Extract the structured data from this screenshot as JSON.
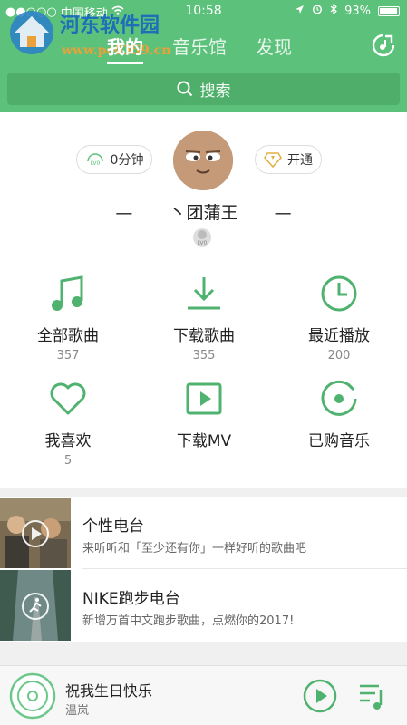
{
  "status": {
    "carrier": "中国移动",
    "time": "10:58",
    "battery": "93%"
  },
  "watermark": {
    "title": "河东软件园",
    "url": "www.pc0359.cn"
  },
  "nav": {
    "tabs": [
      {
        "label": "我的",
        "active": true
      },
      {
        "label": "音乐馆",
        "active": false
      },
      {
        "label": "发现",
        "active": false
      }
    ]
  },
  "search": {
    "placeholder": "搜索"
  },
  "profile": {
    "listen_time": "0分钟",
    "listen_badge": "LV0",
    "vip_label": "开通",
    "username": "丶团蒲王",
    "dash": "—",
    "level_badge": "LV0"
  },
  "grid": [
    {
      "label": "全部歌曲",
      "count": "357",
      "icon": "music-note-icon"
    },
    {
      "label": "下载歌曲",
      "count": "355",
      "icon": "download-icon"
    },
    {
      "label": "最近播放",
      "count": "200",
      "icon": "clock-icon"
    },
    {
      "label": "我喜欢",
      "count": "5",
      "icon": "heart-icon"
    },
    {
      "label": "下载MV",
      "count": "",
      "icon": "video-play-icon"
    },
    {
      "label": "已购音乐",
      "count": "",
      "icon": "purchased-disc-icon"
    }
  ],
  "radios": [
    {
      "title": "个性电台",
      "desc": "来听听和「至少还有你」一样好听的歌曲吧"
    },
    {
      "title": "NIKE跑步电台",
      "desc": "新增万首中文跑步歌曲，点燃你的2017!"
    }
  ],
  "player": {
    "title": "祝我生日快乐",
    "artist": "温岚"
  },
  "colors": {
    "brand_green": "#5cc17a",
    "icon_green": "#4fb26f"
  }
}
